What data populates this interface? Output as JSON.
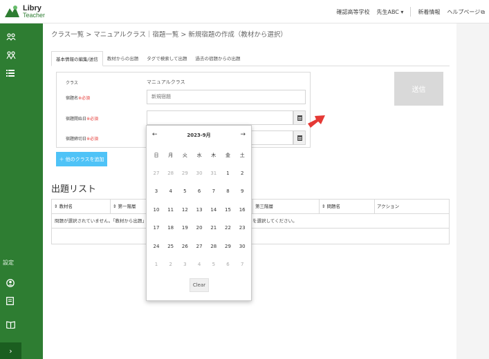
{
  "header": {
    "logo_line1": "Libry",
    "logo_line2": "Teacher",
    "school": "確認高等学校",
    "user": "先生ABC ▾",
    "news": "新着情報",
    "help": "ヘルプページ",
    "help_icon": "external-link-icon",
    "colors": {
      "brand_green": "#2e7d32"
    }
  },
  "sidebar": {
    "items": [
      {
        "icon": "users-icon"
      },
      {
        "icon": "users-outline-icon"
      },
      {
        "icon": "list-icon"
      }
    ],
    "settings_label": "設定",
    "bottom_items": [
      {
        "icon": "user-circle-icon"
      },
      {
        "icon": "assignment-icon"
      },
      {
        "icon": "book-icon"
      }
    ],
    "expand_label": "›"
  },
  "main": {
    "breadcrumb": "クラス一覧 > マニュアルクラス｜宿題一覧 > 新規宿題の作成（教材から選択）",
    "tabs": [
      {
        "label": "基本情報の編集/送信",
        "active": true
      },
      {
        "label": "教材からの出題",
        "active": false
      },
      {
        "label": "タグで検索して出題",
        "active": false
      },
      {
        "label": "過去の宿題からの出題",
        "active": false
      }
    ],
    "form": {
      "class_label": "クラス",
      "class_value": "マニュアルクラス",
      "title_label": "宿題名",
      "title_required": "※必須",
      "title_value": "新規宿題",
      "start_label": "宿題開始日",
      "start_required": "※必須",
      "end_label": "宿題締切日",
      "end_required": "※必須"
    },
    "send_label": "送信",
    "add_class_label": "＋ 他のクラスを追加",
    "list_title": "出題リスト",
    "table_headers": [
      "⇕ 教材名",
      "⇕ 第一階層",
      "第三階層",
      "⇕ 問題名",
      "アクション"
    ],
    "empty_message_left": "問題が選択されていません。「教材から出題」を",
    "empty_message_right": "を選択してください。"
  },
  "calendar": {
    "month_label": "2023-9月",
    "prev": "←",
    "next": "→",
    "weekdays": [
      "日",
      "月",
      "火",
      "水",
      "木",
      "金",
      "土"
    ],
    "weeks": [
      [
        "27",
        "28",
        "29",
        "30",
        "31",
        "1",
        "2"
      ],
      [
        "3",
        "4",
        "5",
        "6",
        "7",
        "8",
        "9"
      ],
      [
        "10",
        "11",
        "12",
        "13",
        "14",
        "15",
        "16"
      ],
      [
        "17",
        "18",
        "19",
        "20",
        "21",
        "22",
        "23"
      ],
      [
        "24",
        "25",
        "26",
        "27",
        "28",
        "29",
        "30"
      ],
      [
        "1",
        "2",
        "3",
        "4",
        "5",
        "6",
        "7"
      ]
    ],
    "muted": [
      [
        true,
        true,
        true,
        true,
        true,
        false,
        false
      ],
      [
        false,
        false,
        false,
        false,
        false,
        false,
        false
      ],
      [
        false,
        false,
        false,
        false,
        false,
        false,
        false
      ],
      [
        false,
        false,
        false,
        false,
        false,
        false,
        false
      ],
      [
        false,
        false,
        false,
        false,
        false,
        false,
        false
      ],
      [
        true,
        true,
        true,
        true,
        true,
        true,
        true
      ]
    ],
    "clear_label": "Clear"
  },
  "annotation": {
    "arrow_color": "#e53935"
  }
}
